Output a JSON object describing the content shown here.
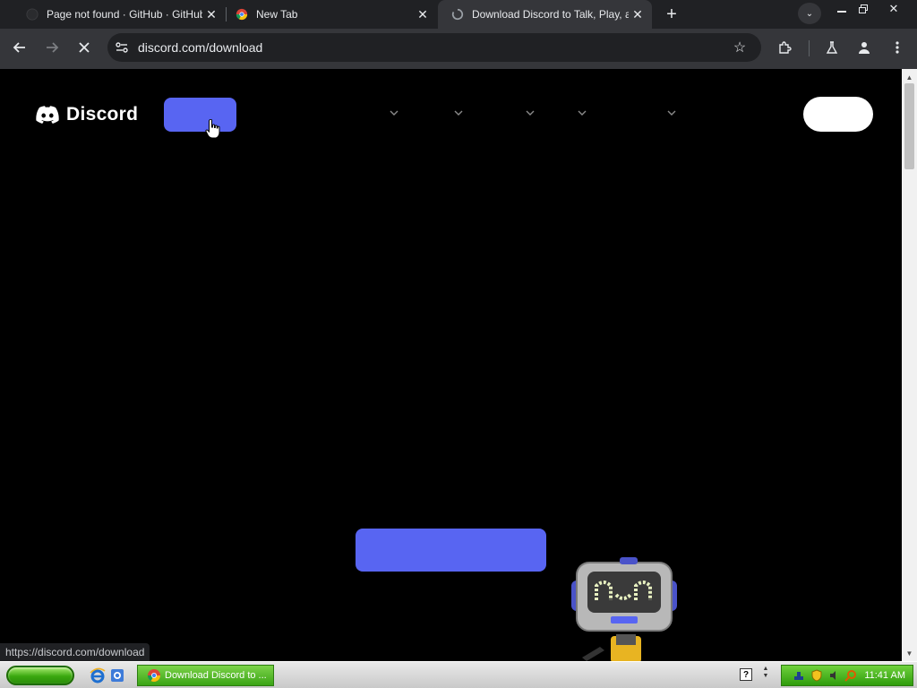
{
  "browser": {
    "tabs": [
      {
        "title": "Page not found · GitHub · GitHub",
        "favicon": "github-icon",
        "active": false
      },
      {
        "title": "New Tab",
        "favicon": "chrome-icon",
        "active": false
      },
      {
        "title": "Download Discord to Talk, Play, and Hang Out",
        "favicon": "loading-icon",
        "active": true
      }
    ],
    "omnibox": {
      "url": "discord.com/download"
    },
    "status_url": "https://discord.com/download"
  },
  "page": {
    "logo_text": "Discord",
    "brand_color": "#5865f2",
    "nav_chevron_count": 5
  },
  "taskbar": {
    "task_item": "Download Discord to ...",
    "clock": "11:41 AM"
  }
}
